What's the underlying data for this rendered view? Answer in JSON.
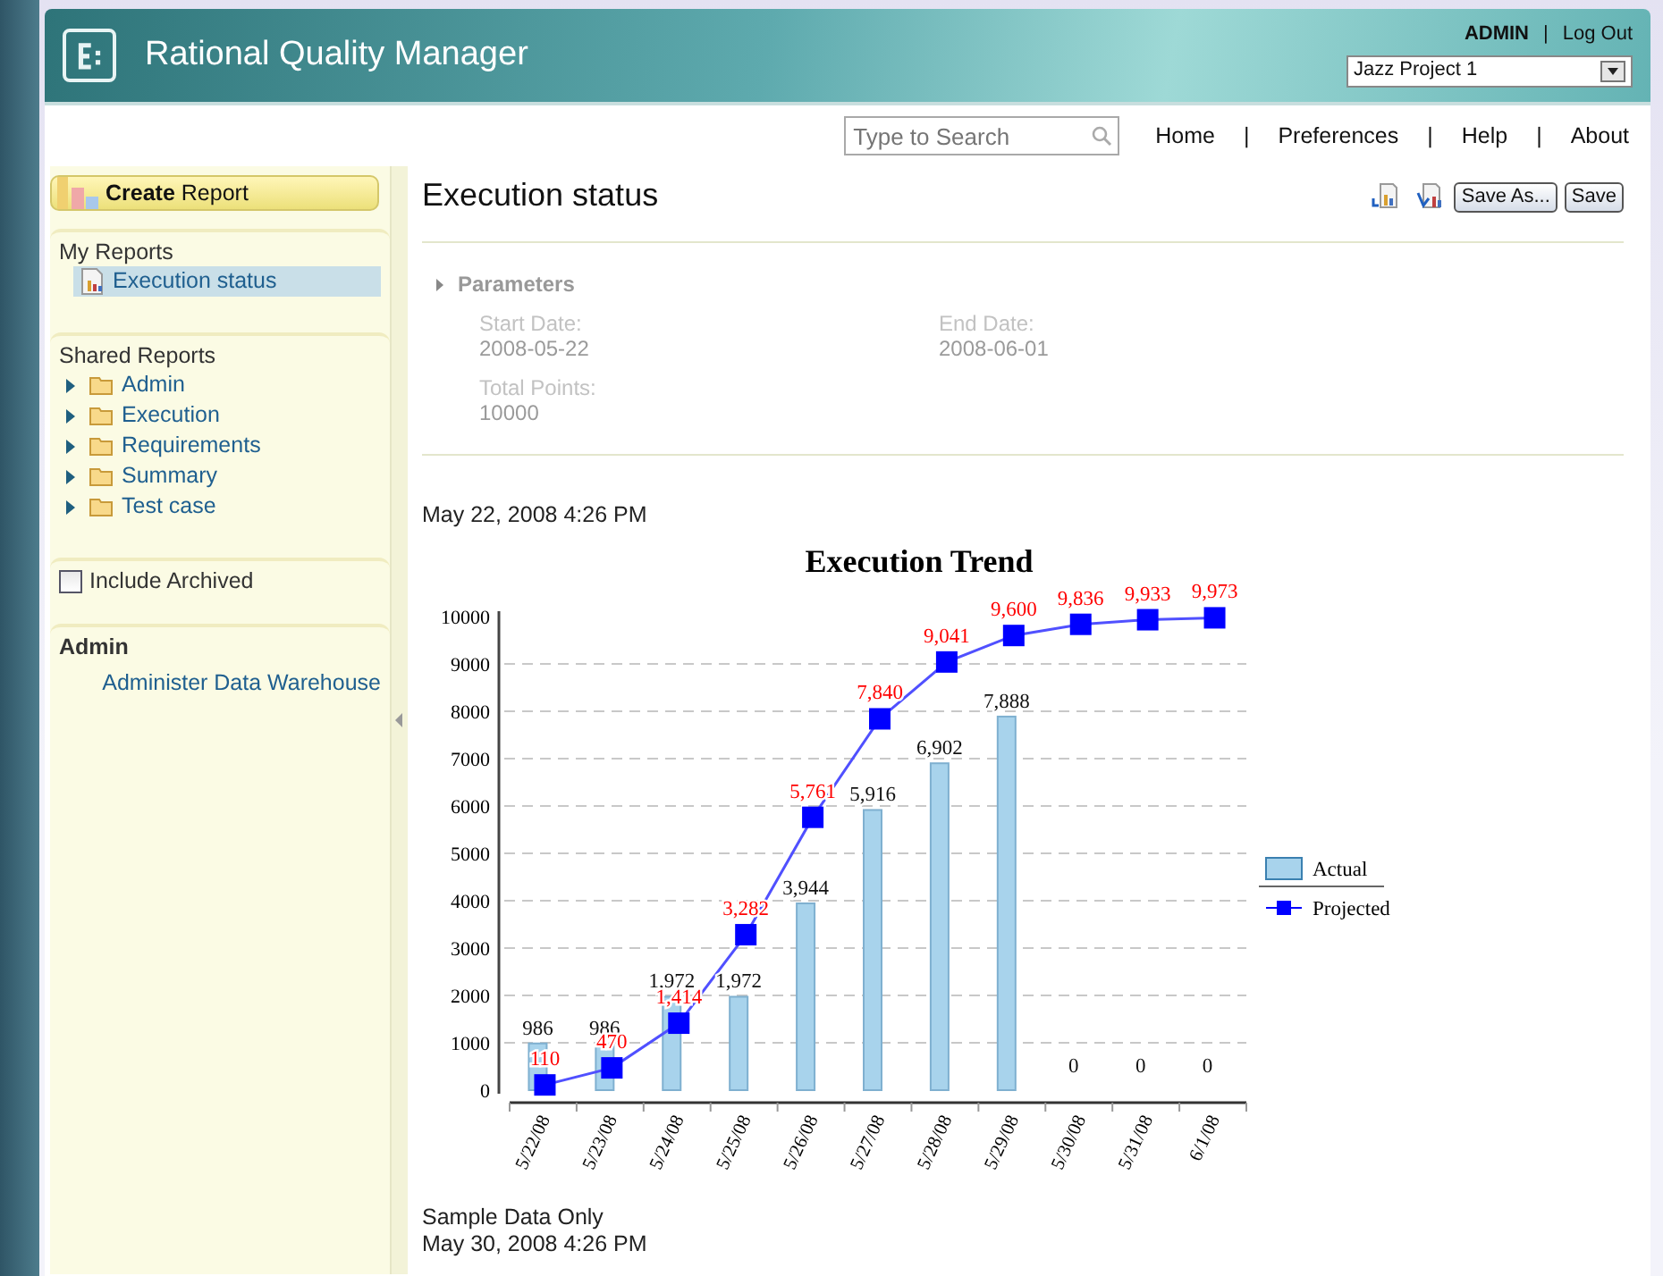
{
  "header": {
    "title": "Rational Quality Manager",
    "user": "ADMIN",
    "separator": "|",
    "logout": "Log Out",
    "project": "Jazz Project 1"
  },
  "nav": {
    "search_placeholder": "Type to Search",
    "separator": "|",
    "links": [
      "Home",
      "Preferences",
      "Help",
      "About"
    ]
  },
  "sidebar": {
    "create_button": {
      "bold": "Create",
      "rest": "Report"
    },
    "my_reports": {
      "heading": "My Reports",
      "items": [
        {
          "label": "Execution status",
          "selected": true
        }
      ]
    },
    "shared_reports": {
      "heading": "Shared Reports",
      "folders": [
        {
          "label": "Admin"
        },
        {
          "label": "Execution"
        },
        {
          "label": "Requirements"
        },
        {
          "label": "Summary"
        },
        {
          "label": "Test case"
        }
      ]
    },
    "include_archived": {
      "label": "Include Archived",
      "checked": false
    },
    "admin": {
      "heading": "Admin",
      "links": [
        "Administer Data Warehouse"
      ]
    }
  },
  "main": {
    "title": "Execution status",
    "buttons": [
      "Save As...",
      "Save"
    ],
    "parameters": {
      "heading": "Parameters",
      "fields": [
        {
          "label": "Start Date:",
          "value": "2008-05-22"
        },
        {
          "label": "End Date:",
          "value": "2008-06-01"
        },
        {
          "label": "Total Points:",
          "value": "10000"
        }
      ]
    },
    "report_date": "May 22, 2008 4:26 PM",
    "chart_data": {
      "type": "bar",
      "title": "Execution Trend",
      "categories": [
        "5/22/08",
        "5/23/08",
        "5/24/08",
        "5/25/08",
        "5/26/08",
        "5/27/08",
        "5/28/08",
        "5/29/08",
        "5/30/08",
        "5/31/08",
        "6/1/08"
      ],
      "series": [
        {
          "name": "Actual",
          "type": "bar",
          "color": "#a8d3ec",
          "values": [
            986,
            986,
            1972,
            1972,
            3944,
            5916,
            6902,
            7888,
            0,
            0,
            0
          ],
          "value_labels": [
            "986",
            "986",
            "1,972",
            "1,972",
            "3,944",
            "5,916",
            "6,902",
            "7,888",
            "0",
            "0",
            "0"
          ]
        },
        {
          "name": "Projected",
          "type": "line",
          "color": "#0000ff",
          "marker": "square",
          "values": [
            110,
            470,
            1414,
            3282,
            5761,
            7840,
            9041,
            9600,
            9836,
            9933,
            9973
          ],
          "value_labels": [
            "110",
            "470",
            "1,414",
            "3,282",
            "5,761",
            "7,840",
            "9,041",
            "9,600",
            "9,836",
            "9,933",
            "9,973"
          ]
        }
      ],
      "ylim": [
        0,
        10000
      ],
      "yticks": [
        0,
        1000,
        2000,
        3000,
        4000,
        5000,
        6000,
        7000,
        8000,
        9000,
        10000
      ],
      "grid": true,
      "legend": "right"
    },
    "footer": [
      "Sample Data Only",
      "May 30, 2008 4:26 PM"
    ]
  }
}
